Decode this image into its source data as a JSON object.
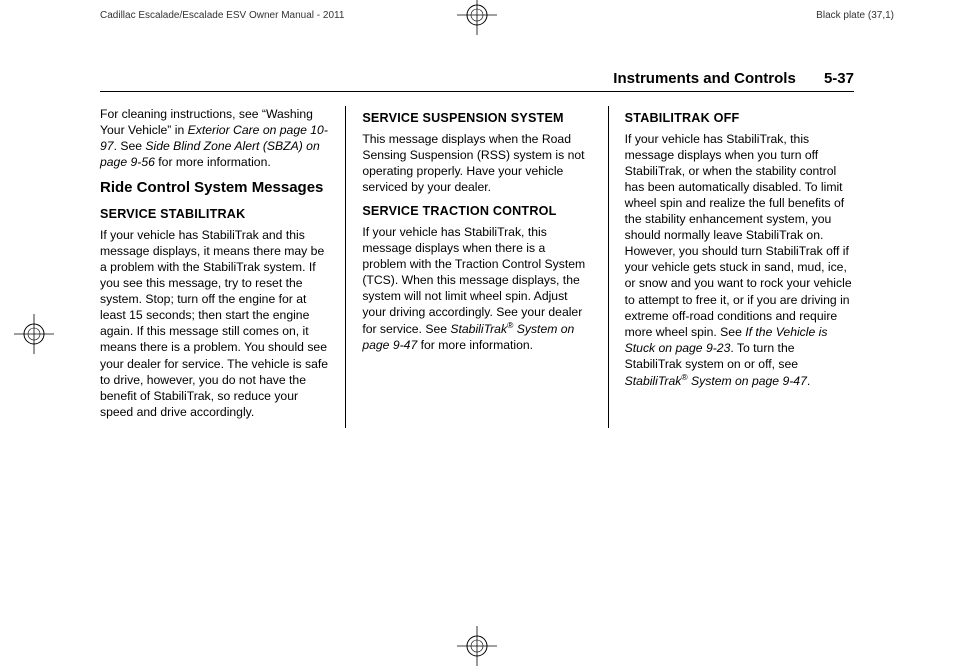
{
  "print": {
    "manual_title": "Cadillac Escalade/Escalade ESV Owner Manual - 2011",
    "plate": "Black plate (37,1)"
  },
  "header": {
    "section": "Instruments and Controls",
    "page": "5-37"
  },
  "col1": {
    "intro_a": "For cleaning instructions, see “Washing Your Vehicle” in ",
    "intro_ital1": "Exterior Care on page 10-97",
    "intro_b": ". See ",
    "intro_ital2": "Side Blind Zone Alert (SBZA) on page 9-56",
    "intro_c": " for more information.",
    "h2": "Ride Control System Messages",
    "h3": "SERVICE STABILITRAK",
    "body": "If your vehicle has StabiliTrak and this message displays, it means there may be a problem with the StabiliTrak system. If you see this message, try to reset the system. Stop; turn off the engine for at least 15 seconds; then start the engine again. If this message still comes on, it means there is a problem. You should see your dealer for service. The vehicle is safe to drive, however, you do not have the benefit of StabiliTrak, so reduce your speed and drive accordingly."
  },
  "col2": {
    "h3a": "SERVICE SUSPENSION SYSTEM",
    "body_a": "This message displays when the Road Sensing Suspension (RSS) system is not operating properly. Have your vehicle serviced by your dealer.",
    "h3b": "SERVICE TRACTION CONTROL",
    "body_b1": "If your vehicle has StabiliTrak, this message displays when there is a problem with the Traction Control System (TCS). When this message displays, the system will not limit wheel spin. Adjust your driving accordingly. See your dealer for service. See ",
    "body_b_ital": "StabiliTrak",
    "body_b_sup": "®",
    "body_b_ital2": " System on page 9-47",
    "body_b2": " for more information."
  },
  "col3": {
    "h3": "STABILITRAK OFF",
    "body1": "If your vehicle has StabiliTrak, this message displays when you turn off StabiliTrak, or when the stability control has been automatically disabled. To limit wheel spin and realize the full benefits of the stability enhancement system, you should normally leave StabiliTrak on. However, you should turn StabiliTrak off if your vehicle gets stuck in sand, mud, ice, or snow and you want to rock your vehicle to attempt to free it, or if you are driving in extreme off-road conditions and require more wheel spin. See ",
    "body_ital1": "If the Vehicle is Stuck on page 9-23",
    "body2": ". To turn the StabiliTrak system on or off, see ",
    "body_ital2": "StabiliTrak",
    "body_sup": "®",
    "body_ital3": " System on page 9-47",
    "body3": "."
  }
}
